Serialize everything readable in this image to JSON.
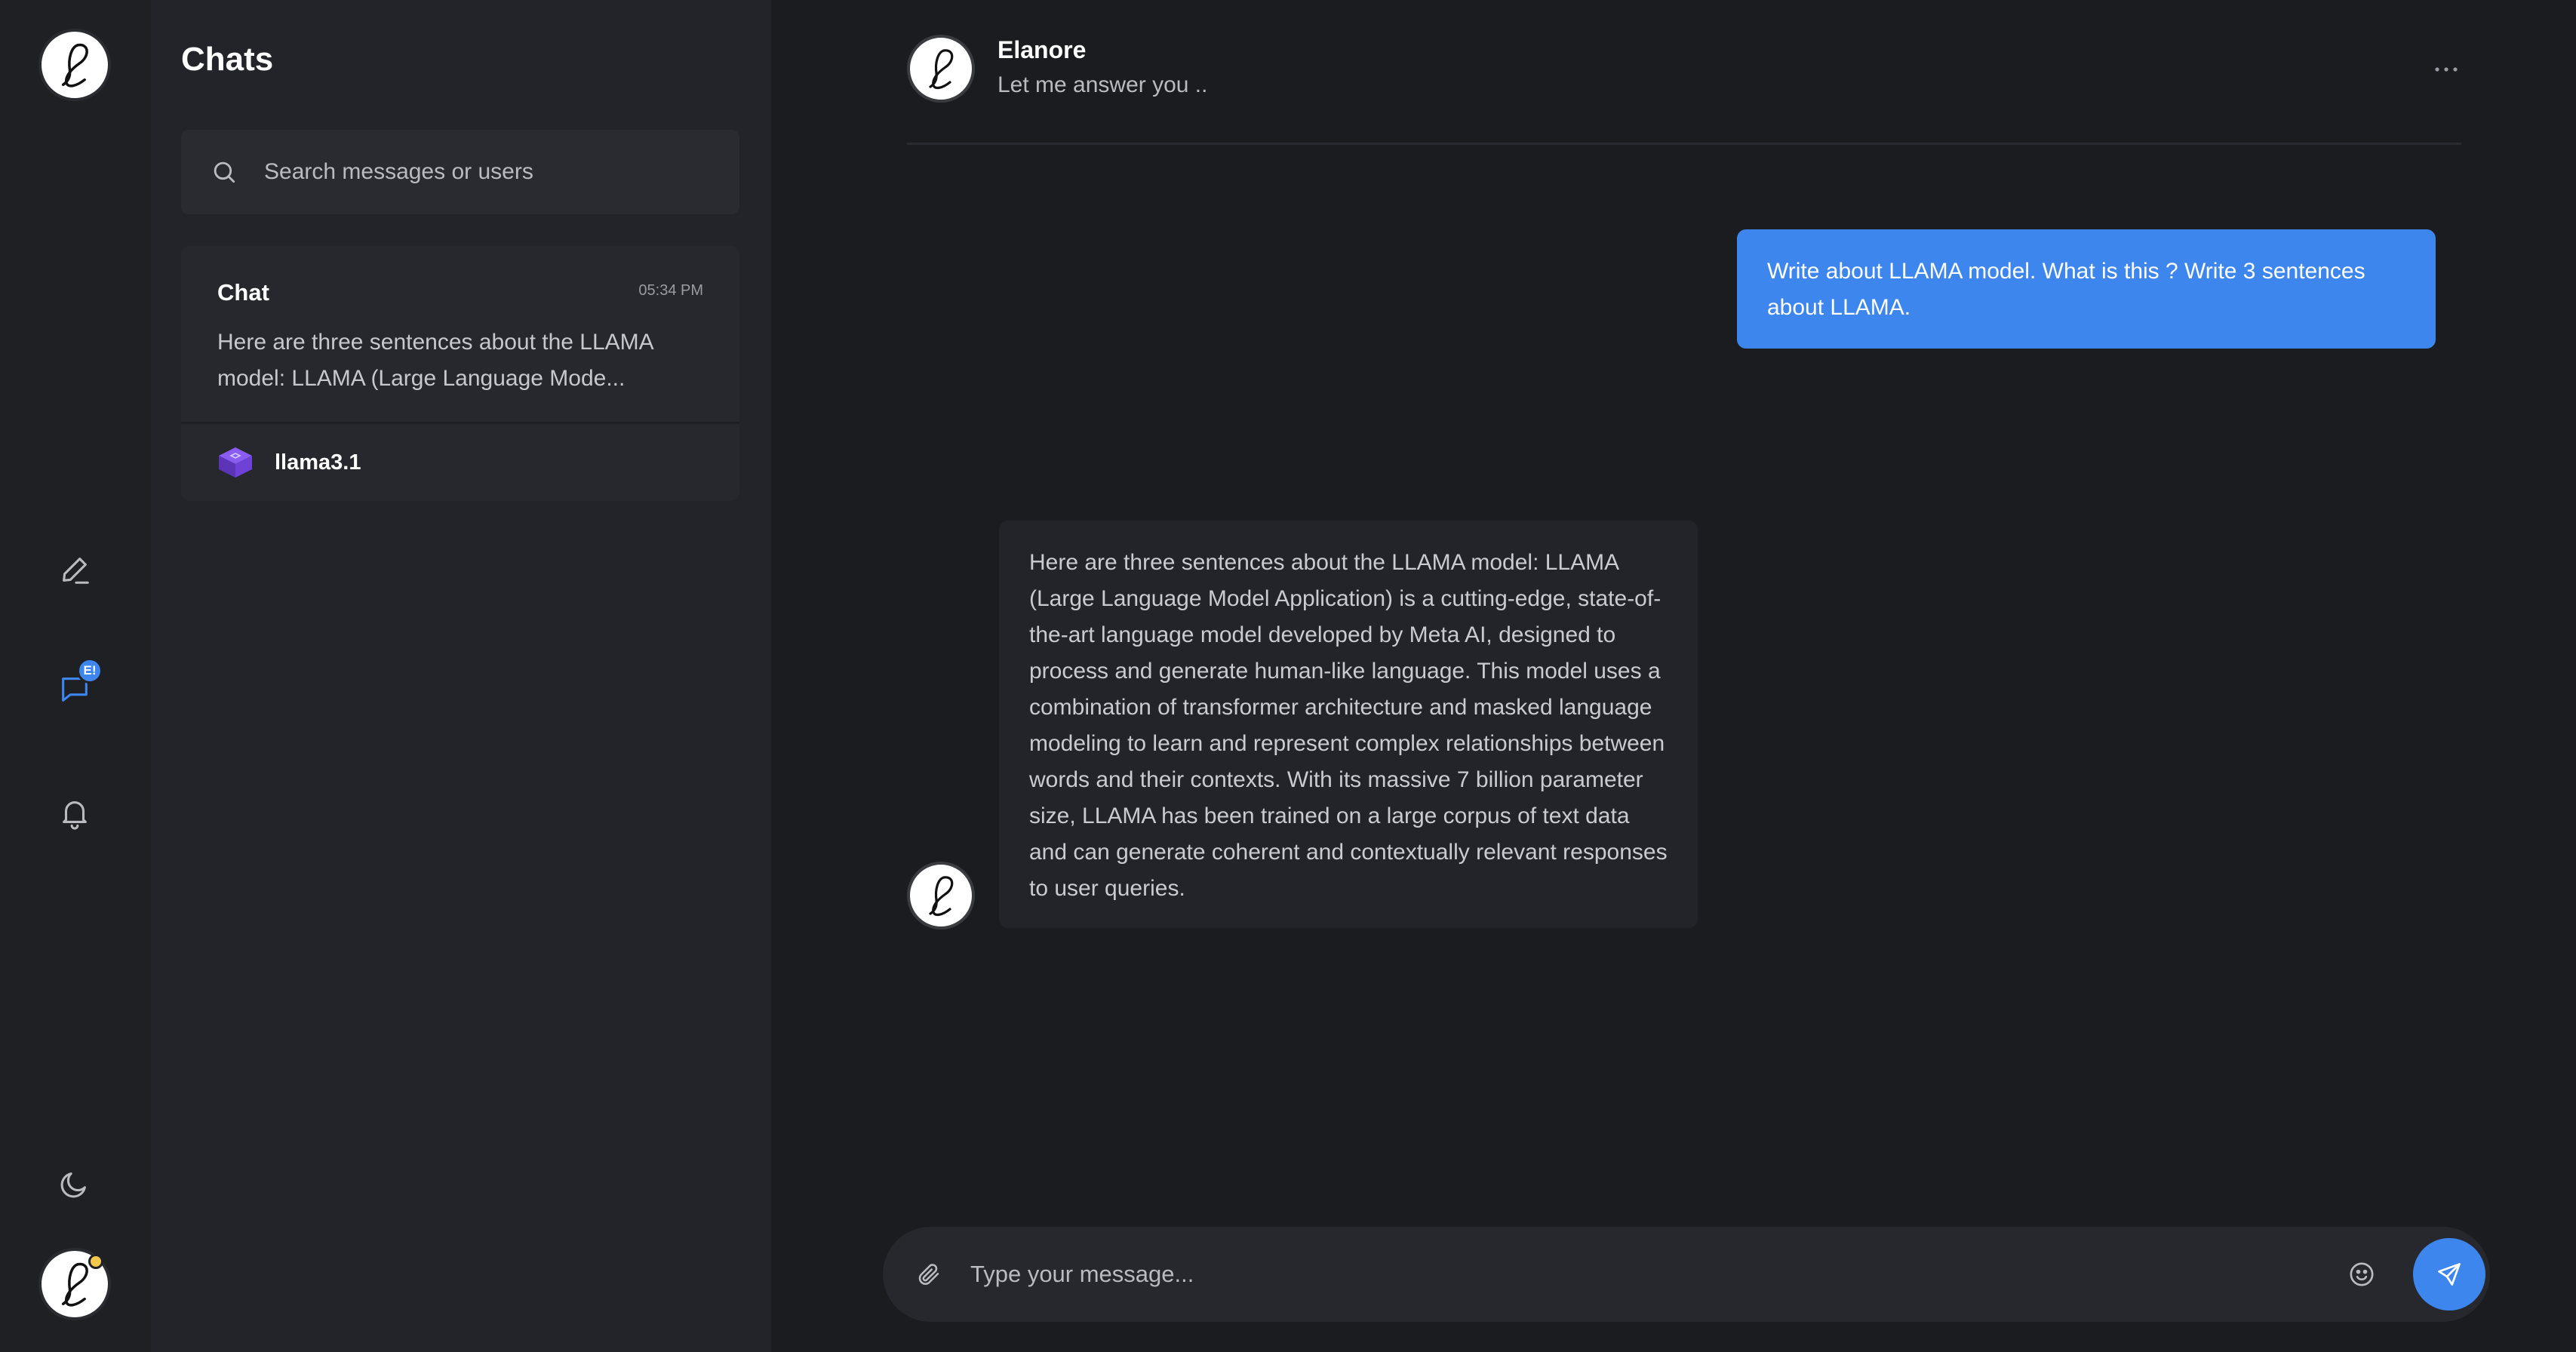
{
  "rail": {
    "icons": [
      "logo-avatar",
      "edit-icon",
      "chat-icon",
      "bell-icon",
      "moon-icon",
      "user-avatar"
    ],
    "chat_badge": "E!",
    "status_color": "#f2c94c"
  },
  "sidebar": {
    "title": "Chats",
    "search": {
      "placeholder": "Search messages or users"
    },
    "chats": [
      {
        "name": "Chat",
        "time": "05:34 PM",
        "preview": "Here are three sentences about the LLAMA model: LLAMA (Large Language Mode...",
        "model": "llama3.1"
      }
    ]
  },
  "conversation": {
    "contact_name": "Elanore",
    "status": "Let me answer you ..",
    "messages": [
      {
        "direction": "outgoing",
        "text": "Write about LLAMA model. What is this ? Write 3 sentences about LLAMA."
      },
      {
        "direction": "incoming",
        "text": "Here are three sentences about the LLAMA model: LLAMA (Large Language Model Application) is a cutting-edge, state-of-the-art language model developed by Meta AI, designed to process and generate human-like language. This model uses a combination of transformer architecture and masked language modeling to learn and represent complex relationships between words and their contexts. With its massive 7 billion parameter size, LLAMA has been trained on a large corpus of text data and can generate coherent and contextually relevant responses to user queries."
      }
    ],
    "composer": {
      "placeholder": "Type your message..."
    }
  },
  "colors": {
    "accent": "#3d86ee",
    "background": "#1b1c20",
    "panel": "#232429"
  }
}
